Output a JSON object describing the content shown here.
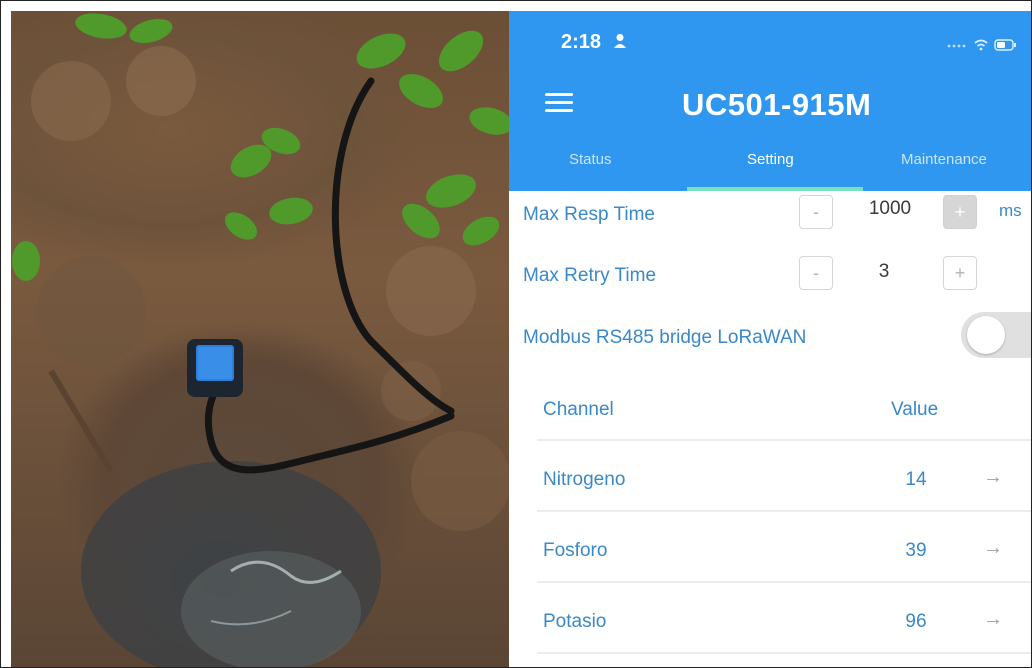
{
  "status_bar": {
    "time": "2:18"
  },
  "header": {
    "title": "UC501-915M"
  },
  "tabs": [
    {
      "label": "Status",
      "active": false
    },
    {
      "label": "Setting",
      "active": true
    },
    {
      "label": "Maintenance",
      "active": false
    }
  ],
  "settings": {
    "max_resp_time": {
      "label": "Max Resp Time",
      "value": "1000",
      "unit": "ms"
    },
    "max_retry_time": {
      "label": "Max Retry Time",
      "value": "3"
    },
    "modbus_bridge": {
      "label": "Modbus RS485 bridge LoRaWAN",
      "enabled": false
    }
  },
  "stepper": {
    "minus": "-",
    "plus": "+"
  },
  "channel_table": {
    "headers": {
      "channel": "Channel",
      "value": "Value"
    },
    "rows": [
      {
        "channel": "Nitrogeno",
        "value": "14"
      },
      {
        "channel": "Fosforo",
        "value": "39"
      },
      {
        "channel": "Potasio",
        "value": "96"
      }
    ],
    "arrow": "→"
  },
  "colors": {
    "app_bar": "#2f97f0",
    "label_text": "#3a88c9",
    "tab_indicator": "#7be0c0",
    "toggle_off": "#e0e0e0"
  },
  "photo": {
    "subject": "soil sensor buried in dirt hole with black cable"
  }
}
